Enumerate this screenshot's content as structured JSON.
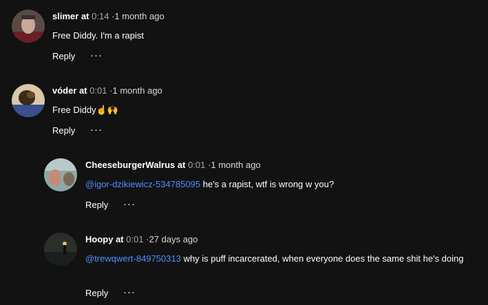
{
  "comments": [
    {
      "username": "slimer",
      "at": "at",
      "timestamp": "0:14",
      "separator": "·",
      "age": "1 month ago",
      "mention": "",
      "text": "Free Diddy. I'm a rapist",
      "reply_label": "Reply",
      "more_label": "···"
    },
    {
      "username": "vóder",
      "at": "at",
      "timestamp": "0:01",
      "separator": "·",
      "age": "1 month ago",
      "mention": "",
      "text": "Free Diddy☝️🙌",
      "reply_label": "Reply",
      "more_label": "···"
    }
  ],
  "replies": [
    {
      "username": "CheeseburgerWalrus",
      "at": "at",
      "timestamp": "0:01",
      "separator": "·",
      "age": "1 month ago",
      "mention": "@igor-dzikiewicz-534785095",
      "text": " he's a rapist, wtf is wrong w you?",
      "reply_label": "Reply",
      "more_label": "···"
    },
    {
      "username": "Hoopy",
      "at": "at",
      "timestamp": "0:01",
      "separator": "·",
      "age": "27 days ago",
      "mention": "@trewqwert-849750313",
      "text": " why is puff incarcerated, when everyone does the same shit he's doing",
      "reply_label": "Reply",
      "more_label": "···"
    }
  ],
  "colors": {
    "background": "#121212",
    "mention": "#4e8fff",
    "timestamp": "#a7a7a7"
  }
}
